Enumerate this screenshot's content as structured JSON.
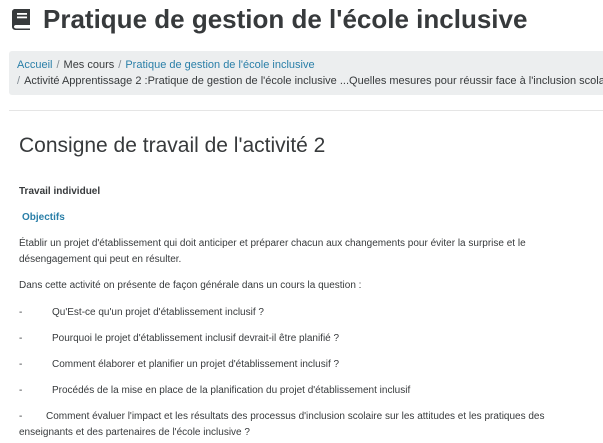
{
  "header": {
    "book_icon": "book-icon",
    "title": "Pratique de gestion de l'école inclusive"
  },
  "breadcrumb": {
    "items": [
      "Accueil",
      "Mes cours",
      "Pratique de gestion de l'école inclusive",
      "Activité Apprentissage 2 :Pratique de gestion de l'école inclusive ...Quelles mesures pour réussir face à l'inclusion scolaire ?"
    ],
    "separator": "/"
  },
  "main": {
    "title": "Consigne de travail de l'activité 2",
    "travail": "Travail individuel",
    "objectifs": "Objectifs",
    "intro": "Établir un projet d'établissement qui  doit anticiper et préparer chacun aux changements pour éviter la surprise et le désengagement qui peut en résulter.",
    "presente": "Dans cette activité on présente  de façon générale dans un cours la question :",
    "dash": "-",
    "questions": [
      "Qu'Est-ce qu'un projet d'établissement inclusif ?",
      "Pourquoi le projet d'établissement inclusif devrait-il être planifié ?",
      "Comment élaborer et planifier un projet d'établissement inclusif ?",
      "Procédés de la mise en place de la planification du projet d'établissement inclusif",
      "Comment évaluer l'impact et les résultats des processus d'inclusion scolaire sur les attitudes et les pratiques des enseignants et des partenaires de l'école inclusive ?"
    ]
  },
  "colors": {
    "link": "#2a7fa8",
    "text": "#373a3c",
    "breadcrumb_bg": "#eceeef"
  }
}
